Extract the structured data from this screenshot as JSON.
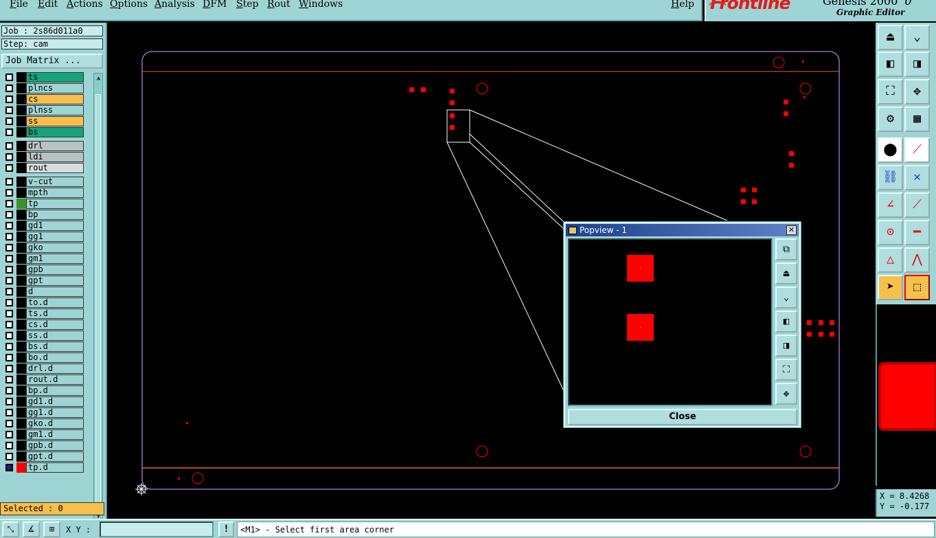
{
  "menubar": {
    "items": [
      "File",
      "Edit",
      "Actions",
      "Options",
      "Analysis",
      "DFM",
      "Step",
      "Rout",
      "Windows"
    ],
    "help": "Help"
  },
  "brand": {
    "logo": "Frontline",
    "product": "Genesis 2000",
    "version_fragment": "0",
    "subtitle": "Graphic Editor",
    "logo_color": "#e21b1b"
  },
  "job": {
    "job_label": "Job : 2s86d011a0",
    "step_label": "Step: cam",
    "matrix_button": "Job Matrix ..."
  },
  "layers": [
    {
      "name": "ts",
      "color": "#16a37d",
      "swatch": "#000000"
    },
    {
      "name": "plncs",
      "color": "#9fd4d4",
      "swatch": "#000000"
    },
    {
      "name": "cs",
      "color": "#f7bf4c",
      "swatch": "#000000"
    },
    {
      "name": "plnss",
      "color": "#9fd4d4",
      "swatch": "#000000"
    },
    {
      "name": "ss",
      "color": "#f7bf4c",
      "swatch": "#000000"
    },
    {
      "name": "bs",
      "color": "#16a37d",
      "swatch": "#000000"
    },
    {
      "name": "drl",
      "color": "#b8c2c2",
      "swatch": "#000000"
    },
    {
      "name": "ldi",
      "color": "#b8c2c2",
      "swatch": "#000000"
    },
    {
      "name": "rout",
      "color": "#d9dddd",
      "swatch": "#000000"
    },
    {
      "name": "v-cut",
      "color": "#9fd4d4",
      "swatch": "#000000"
    },
    {
      "name": "mpth",
      "color": "#9fd4d4",
      "swatch": "#000000"
    },
    {
      "name": "tp",
      "color": "#9fd4d4",
      "swatch": "#3f8f2a"
    },
    {
      "name": "bp",
      "color": "#9fd4d4",
      "swatch": "#000000"
    },
    {
      "name": "gd1",
      "color": "#9fd4d4",
      "swatch": "#000000"
    },
    {
      "name": "gg1",
      "color": "#9fd4d4",
      "swatch": "#000000"
    },
    {
      "name": "gko",
      "color": "#9fd4d4",
      "swatch": "#000000"
    },
    {
      "name": "gm1",
      "color": "#9fd4d4",
      "swatch": "#000000"
    },
    {
      "name": "gpb",
      "color": "#9fd4d4",
      "swatch": "#000000"
    },
    {
      "name": "gpt",
      "color": "#9fd4d4",
      "swatch": "#000000"
    },
    {
      "name": "d",
      "color": "#9fd4d4",
      "swatch": "#000000"
    },
    {
      "name": "to.d",
      "color": "#9fd4d4",
      "swatch": "#000000"
    },
    {
      "name": "ts.d",
      "color": "#9fd4d4",
      "swatch": "#000000"
    },
    {
      "name": "cs.d",
      "color": "#9fd4d4",
      "swatch": "#000000"
    },
    {
      "name": "ss.d",
      "color": "#9fd4d4",
      "swatch": "#000000"
    },
    {
      "name": "bs.d",
      "color": "#9fd4d4",
      "swatch": "#000000"
    },
    {
      "name": "bo.d",
      "color": "#9fd4d4",
      "swatch": "#000000"
    },
    {
      "name": "drl.d",
      "color": "#9fd4d4",
      "swatch": "#000000"
    },
    {
      "name": "rout.d",
      "color": "#9fd4d4",
      "swatch": "#000000"
    },
    {
      "name": "bp.d",
      "color": "#9fd4d4",
      "swatch": "#000000"
    },
    {
      "name": "gd1.d",
      "color": "#9fd4d4",
      "swatch": "#000000"
    },
    {
      "name": "gg1.d",
      "color": "#9fd4d4",
      "swatch": "#000000"
    },
    {
      "name": "gko.d",
      "color": "#9fd4d4",
      "swatch": "#000000"
    },
    {
      "name": "gm1.d",
      "color": "#9fd4d4",
      "swatch": "#000000"
    },
    {
      "name": "gpb.d",
      "color": "#9fd4d4",
      "swatch": "#000000"
    },
    {
      "name": "gpt.d",
      "color": "#9fd4d4",
      "swatch": "#000000"
    },
    {
      "name": "tp.d",
      "color": "#9fd4d4",
      "swatch": "#ff0000",
      "active": true
    }
  ],
  "selected_label": "Selected : 0",
  "popview": {
    "title": "Popview - 1",
    "close_button": "Close",
    "tools": [
      "zoom-window-icon",
      "pan-up-icon",
      "pan-down-icon",
      "pan-left-icon",
      "pan-right-icon",
      "zoom-home-icon",
      "zoom-fit-icon"
    ]
  },
  "coordinates": {
    "x_label": "X = 8.4268",
    "y_label": "Y = -0.177"
  },
  "statusbar": {
    "xy_label": "X Y :",
    "xy_value": "",
    "warn_label": "!",
    "prompt": "<M1> - Select first area corner"
  },
  "colors": {
    "panel": "#9fd4d4",
    "pad_red": "#ff0000",
    "outline_purple": "#b07ce0",
    "outline_orange": "#e06a2a",
    "highlight_yellow": "#f7bf4c"
  }
}
